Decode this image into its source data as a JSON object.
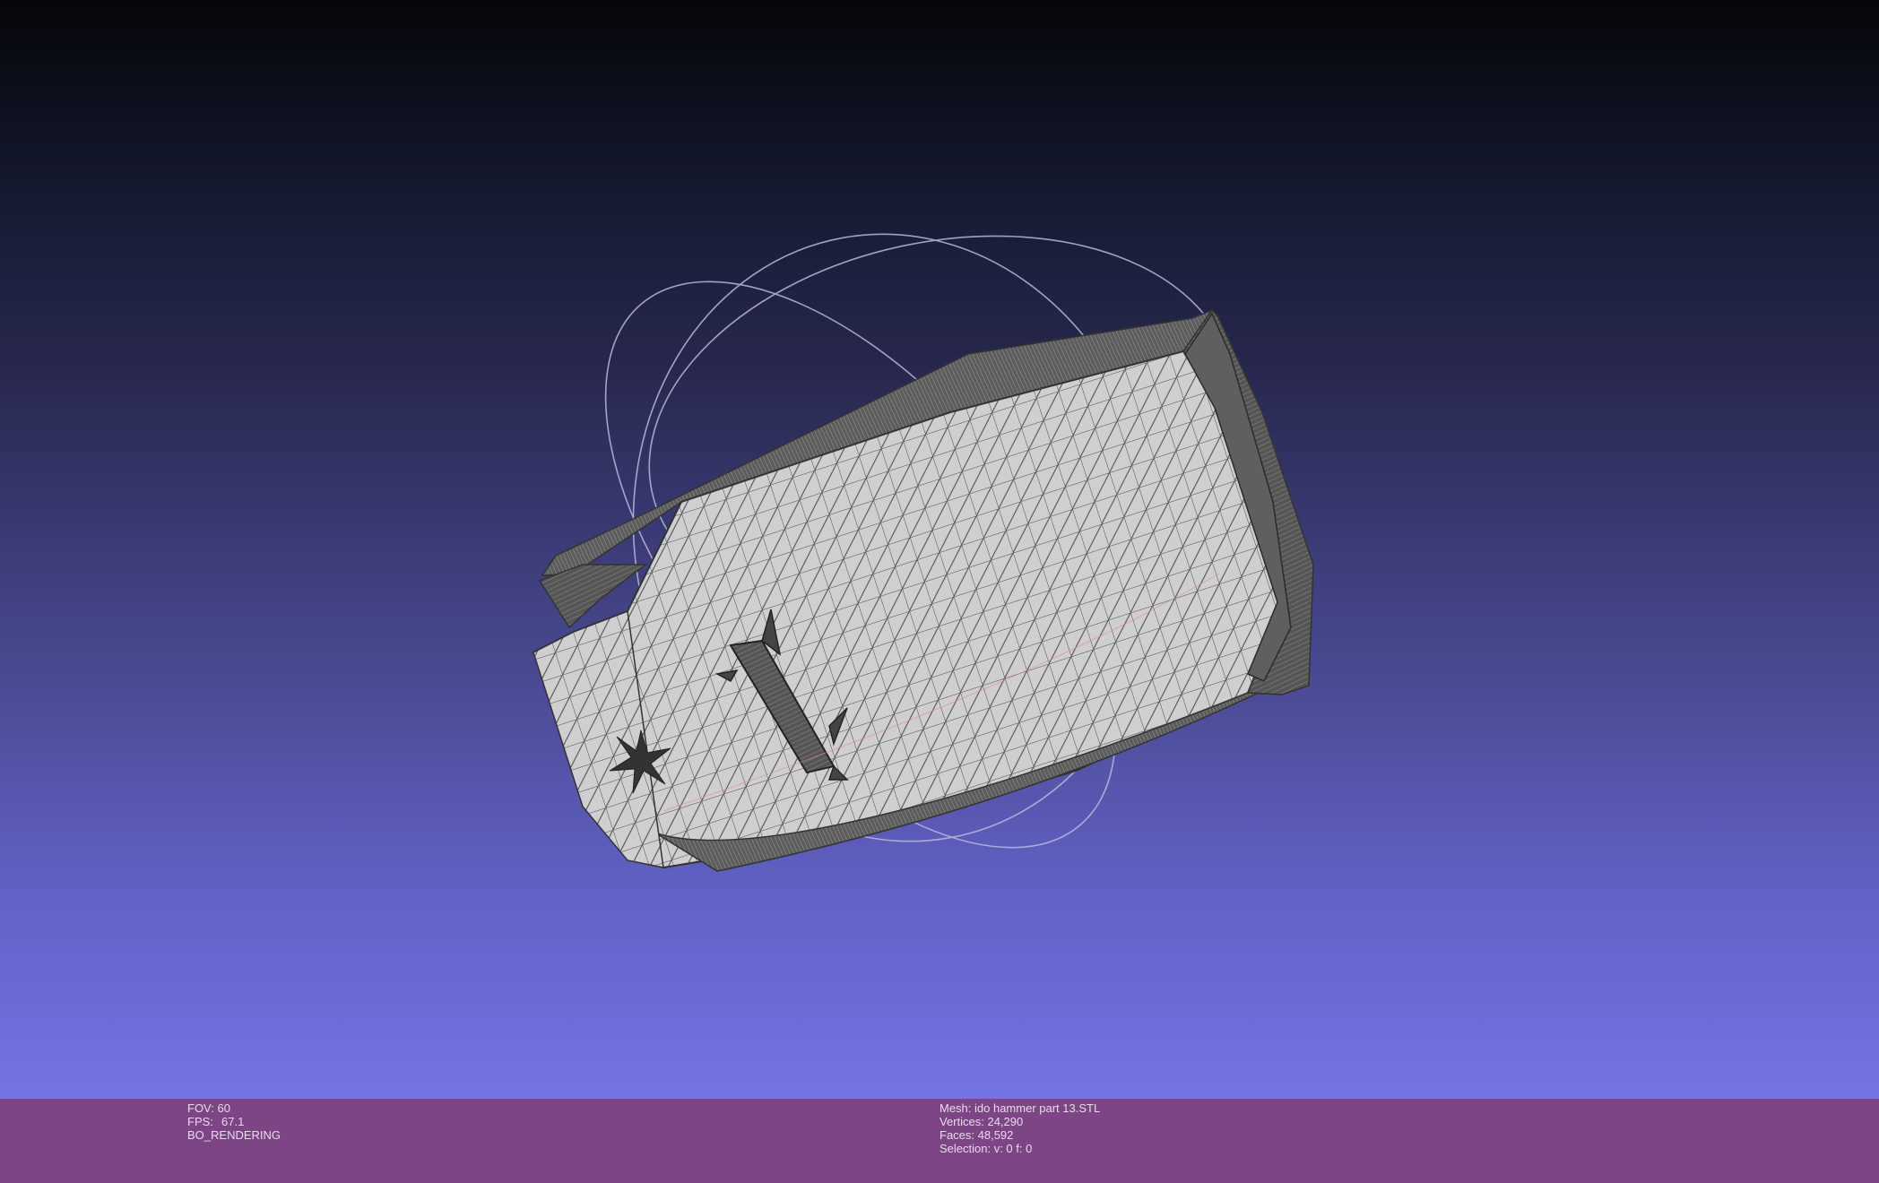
{
  "viewer": {
    "fov_text": "FOV: 60",
    "fps_label": "FPS:",
    "fps_value": "67.1",
    "render_mode": "BO_RENDERING"
  },
  "mesh_info": {
    "mesh": "Mesh: ido hammer part 13.STL",
    "vertices": "Vertices: 24,290",
    "faces": "Faces: 48,592",
    "selection": "Selection: v: 0 f: 0"
  },
  "colors": {
    "background_top": "#050608",
    "background_bottom": "#7474e6",
    "info_bar": "#7e4586",
    "mesh_fill": "#c9c9cc",
    "mesh_wire": "#3a3a3a",
    "trackball": "#b8b8d8"
  },
  "icons": [
    "trackball-gizmo"
  ]
}
